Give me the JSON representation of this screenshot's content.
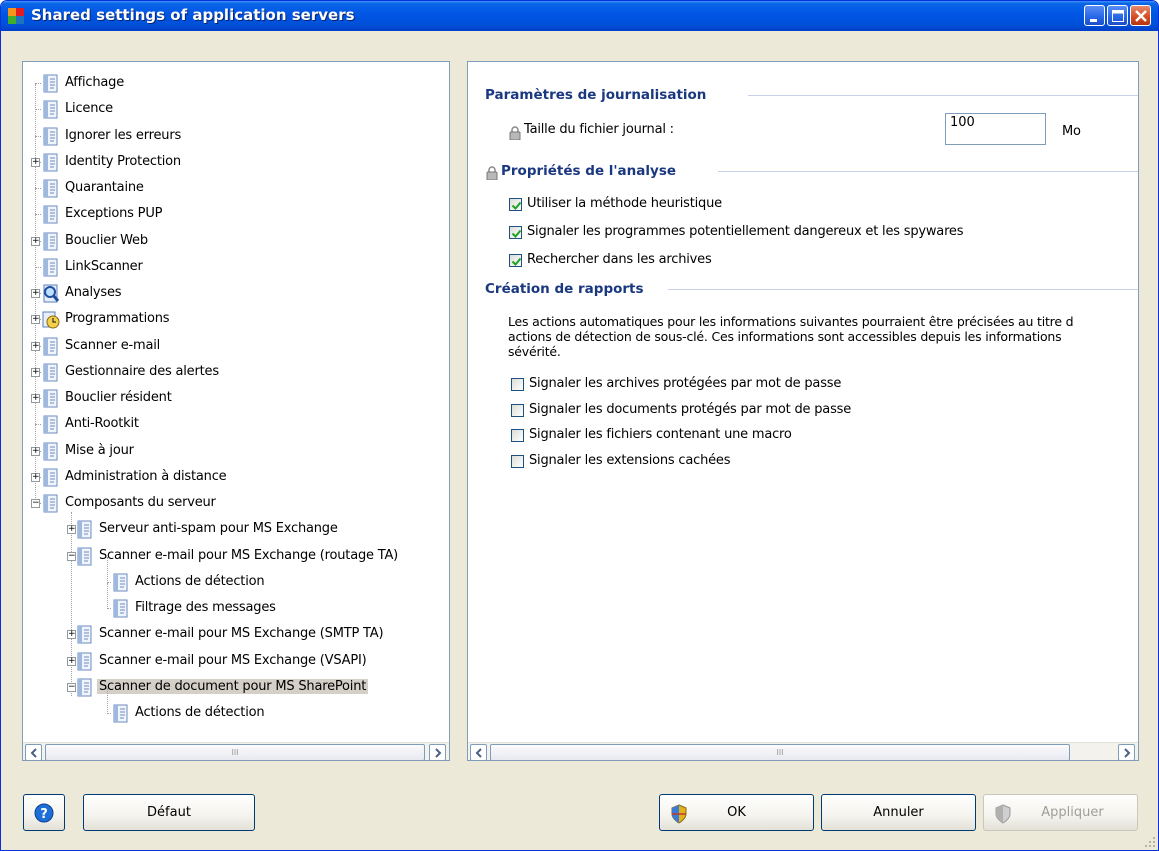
{
  "window": {
    "title": "Shared settings of application servers"
  },
  "tree": {
    "items": [
      {
        "label": "Affichage",
        "level": 0,
        "expander": "none",
        "icon": "document-icon"
      },
      {
        "label": "Licence",
        "level": 0,
        "expander": "none",
        "icon": "document-icon"
      },
      {
        "label": "Ignorer les erreurs",
        "level": 0,
        "expander": "none",
        "icon": "document-icon"
      },
      {
        "label": "Identity Protection",
        "level": 0,
        "expander": "plus",
        "icon": "document-icon"
      },
      {
        "label": "Quarantaine",
        "level": 0,
        "expander": "none",
        "icon": "document-icon"
      },
      {
        "label": "Exceptions PUP",
        "level": 0,
        "expander": "none",
        "icon": "document-icon"
      },
      {
        "label": "Bouclier Web",
        "level": 0,
        "expander": "plus",
        "icon": "document-icon"
      },
      {
        "label": "LinkScanner",
        "level": 0,
        "expander": "none",
        "icon": "document-icon"
      },
      {
        "label": "Analyses",
        "level": 0,
        "expander": "plus",
        "icon": "magnifier-icon"
      },
      {
        "label": "Programmations",
        "level": 0,
        "expander": "plus",
        "icon": "clock-icon"
      },
      {
        "label": "Scanner e-mail",
        "level": 0,
        "expander": "plus",
        "icon": "document-icon"
      },
      {
        "label": "Gestionnaire des alertes",
        "level": 0,
        "expander": "plus",
        "icon": "document-icon"
      },
      {
        "label": "Bouclier résident",
        "level": 0,
        "expander": "plus",
        "icon": "document-icon"
      },
      {
        "label": "Anti-Rootkit",
        "level": 0,
        "expander": "none",
        "icon": "document-icon"
      },
      {
        "label": "Mise à jour",
        "level": 0,
        "expander": "plus",
        "icon": "document-icon"
      },
      {
        "label": "Administration à distance",
        "level": 0,
        "expander": "plus",
        "icon": "document-icon"
      },
      {
        "label": "Composants du serveur",
        "level": 0,
        "expander": "minus",
        "icon": "document-icon"
      },
      {
        "label": "Serveur anti-spam pour MS Exchange",
        "level": 1,
        "expander": "plus",
        "icon": "document-icon"
      },
      {
        "label": "Scanner e-mail pour MS Exchange (routage TA)",
        "level": 1,
        "expander": "minus",
        "icon": "document-icon"
      },
      {
        "label": "Actions de détection",
        "level": 2,
        "expander": "none",
        "icon": "document-icon"
      },
      {
        "label": "Filtrage des messages",
        "level": 2,
        "expander": "none",
        "icon": "document-icon"
      },
      {
        "label": "Scanner e-mail pour MS Exchange (SMTP TA)",
        "level": 1,
        "expander": "plus",
        "icon": "document-icon"
      },
      {
        "label": "Scanner e-mail pour MS Exchange (VSAPI)",
        "level": 1,
        "expander": "plus",
        "icon": "document-icon"
      },
      {
        "label": "Scanner de document pour MS SharePoint",
        "level": 1,
        "expander": "minus",
        "icon": "document-icon",
        "selected": true
      },
      {
        "label": "Actions de détection",
        "level": 2,
        "expander": "none",
        "icon": "document-icon"
      }
    ],
    "scroll_grip": "III"
  },
  "settings": {
    "logging": {
      "title": "Paramètres de journalisation",
      "log_size_label": "Taille du fichier journal :",
      "log_size_value": "100",
      "log_size_unit": "Mo"
    },
    "scan": {
      "title": "Propriétés de l'analyse",
      "options": [
        {
          "label": "Utiliser la méthode heuristique",
          "checked": true
        },
        {
          "label": "Signaler les programmes potentiellement dangereux et les spywares",
          "checked": true
        },
        {
          "label": "Rechercher dans les archives",
          "checked": true
        }
      ]
    },
    "reports": {
      "title": "Création de rapports",
      "desc_line1": "Les actions automatiques pour les informations suivantes pourraient être précisées au titre d",
      "desc_line2": "actions de détection de sous-clé. Ces informations sont accessibles depuis les informations",
      "desc_line3": "sévérité.",
      "options": [
        {
          "label": "Signaler les archives protégées par mot de passe",
          "checked": false
        },
        {
          "label": "Signaler les documents protégés par mot de passe",
          "checked": false
        },
        {
          "label": "Signaler les fichiers contenant une macro",
          "checked": false
        },
        {
          "label": "Signaler les extensions cachées",
          "checked": false
        }
      ]
    },
    "scroll_grip": "III"
  },
  "buttons": {
    "default": "Défaut",
    "ok": "OK",
    "cancel": "Annuler",
    "apply": "Appliquer"
  },
  "colors": {
    "section_title": "#1a3880",
    "titlebar": "#0055e5",
    "selection": "#d4d0c8"
  }
}
